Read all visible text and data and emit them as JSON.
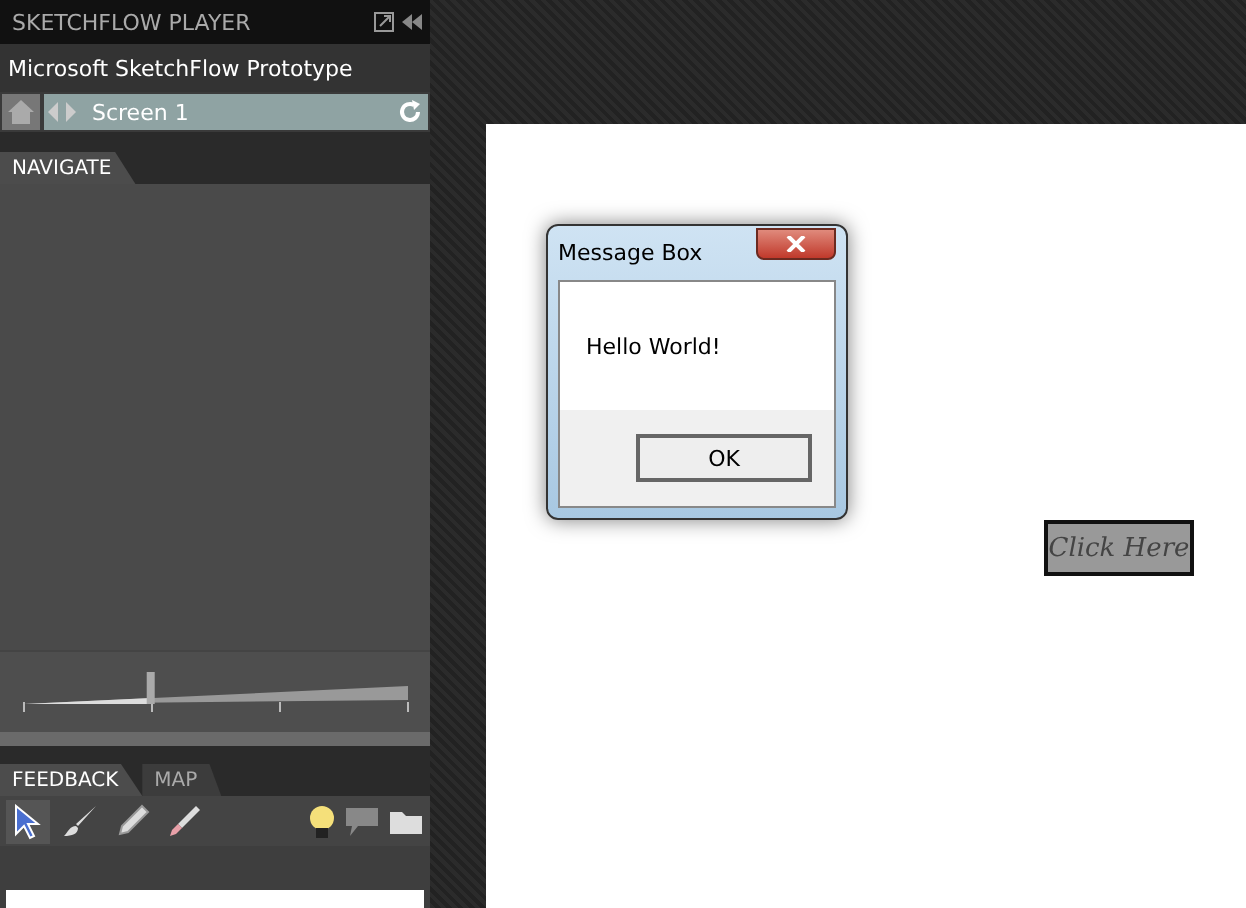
{
  "panel": {
    "title": "SKETCHFLOW PLAYER",
    "project": "Microsoft SketchFlow Prototype"
  },
  "nav": {
    "screen": "Screen 1"
  },
  "navigate_tab": {
    "label": "NAVIGATE",
    "selected": true
  },
  "zoom": {
    "level": 0.33
  },
  "bottom_tabs": [
    {
      "label": "FEEDBACK",
      "selected": true
    },
    {
      "label": "MAP",
      "selected": false
    }
  ],
  "tools": [
    {
      "kind": "pointer",
      "selected": true
    },
    {
      "kind": "brush",
      "selected": false
    },
    {
      "kind": "marker",
      "selected": false
    },
    {
      "kind": "eraser",
      "selected": false
    }
  ],
  "dialog": {
    "title": "Message Box",
    "message": "Hello World!",
    "button": "OK"
  },
  "canvas_button": {
    "label": "Click Here"
  }
}
